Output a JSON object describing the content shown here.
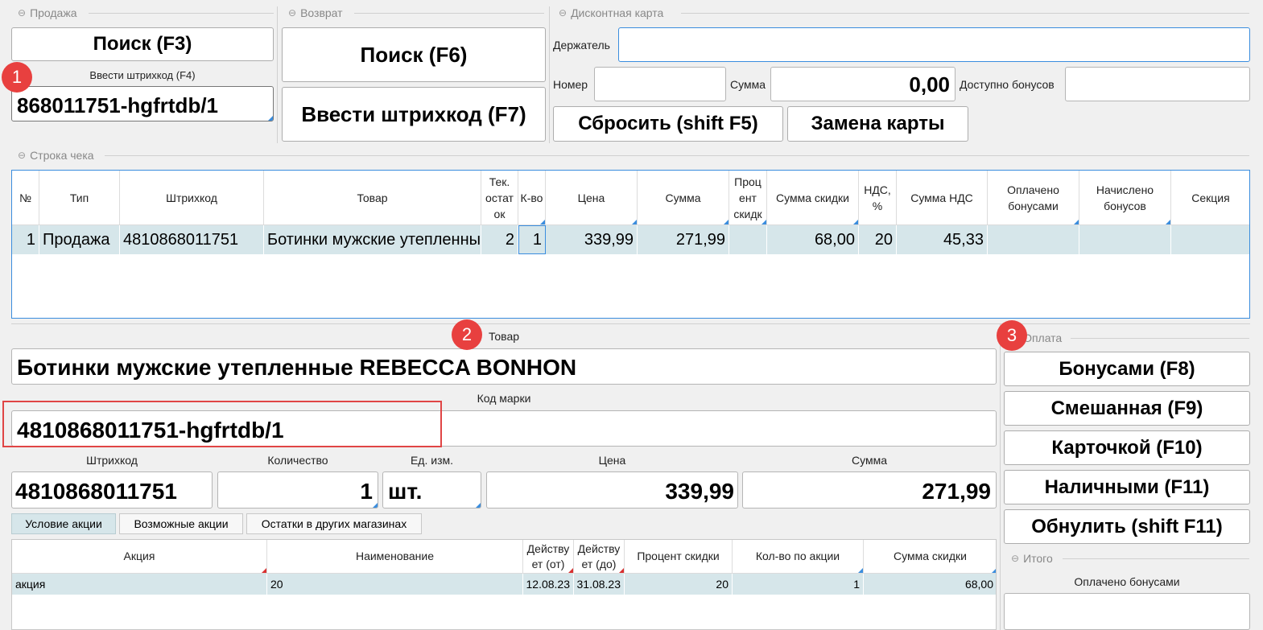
{
  "sale": {
    "group_title": "Продажа",
    "search_label": "Поиск (F3)",
    "barcode_caption": "Ввести штрихкод (F4)",
    "barcode_value": "868011751-hgfrtdb/1"
  },
  "return": {
    "group_title": "Возврат",
    "search_label": "Поиск (F6)",
    "barcode_label": "Ввести штрихкод (F7)"
  },
  "card": {
    "group_title": "Дисконтная карта",
    "holder_label": "Держатель",
    "holder_value": "",
    "number_label": "Номер",
    "number_value": "",
    "sum_label": "Сумма",
    "sum_value": "0,00",
    "bonus_label": "Доступно бонусов",
    "bonus_value": "",
    "reset_label": "Сбросить (shift F5)",
    "replace_label": "Замена карты"
  },
  "receipt": {
    "group_title": "Строка чека",
    "columns": [
      "№",
      "Тип",
      "Штрихкод",
      "Товар",
      "Тек. остат ок",
      "К-во",
      "Цена",
      "Сумма",
      "Проц ент скидк",
      "Сумма скидки",
      "НДС, %",
      "Сумма НДС",
      "Оплачено бонусами",
      "Начислено бонусов",
      "Секция"
    ],
    "row": {
      "no": "1",
      "type": "Продажа",
      "barcode": "4810868011751",
      "product": "Ботинки мужские утепленные REBECCA BONHON",
      "stock": "2",
      "qty": "1",
      "price": "339,99",
      "sum": "271,99",
      "discount_pct": "",
      "discount_sum": "68,00",
      "vat_pct": "20",
      "vat_sum": "45,33",
      "paid_bonus": "",
      "accrued_bonus": "",
      "section": ""
    }
  },
  "product": {
    "title_label": "Товар",
    "name": "Ботинки мужские утепленные REBECCA BONHON",
    "mark_label": "Код марки",
    "mark_value": "4810868011751-hgfrtdb/1",
    "barcode_label": "Штрихкод",
    "barcode_value": "4810868011751",
    "qty_label": "Количество",
    "qty_value": "1",
    "unit_label": "Ед. изм.",
    "unit_value": "шт.",
    "price_label": "Цена",
    "price_value": "339,99",
    "sum_label": "Сумма",
    "sum_value": "271,99"
  },
  "tabs": [
    "Условие акции",
    "Возможные акции",
    "Остатки в других магазинах"
  ],
  "promo": {
    "columns": [
      "Акция",
      "Наименование",
      "Действу ет (от)",
      "Действу ет (до)",
      "Процент скидки",
      "Кол-во по акции",
      "Сумма скидки"
    ],
    "row": {
      "action": "акция",
      "name": "20",
      "from": "12.08.23",
      "to": "31.08.23",
      "pct": "20",
      "qty": "1",
      "sum": "68,00"
    }
  },
  "payment": {
    "group_title": "Оплата",
    "bonus": "Бонусами (F8)",
    "mixed": "Смешанная (F9)",
    "card": "Карточкой (F10)",
    "cash": "Наличными (F11)",
    "reset": "Обнулить (shift F11)"
  },
  "total": {
    "group_title": "Итого",
    "paid_bonus_label": "Оплачено бонусами"
  },
  "markers": [
    "1",
    "2",
    "3"
  ],
  "colors": {
    "accent": "#3a8dde",
    "badge": "#e8403f",
    "highlight_row": "#d6e6ea",
    "focus_box": "#e04545"
  }
}
